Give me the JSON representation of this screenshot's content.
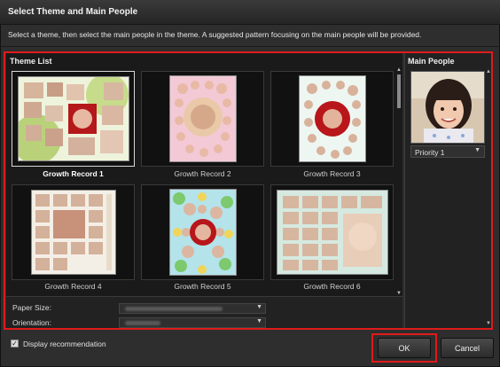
{
  "window": {
    "title": "Select Theme and Main People"
  },
  "instructions": "Select a theme, then select the main people in the theme. A suggested pattern focusing on the main people will be provided.",
  "theme_list": {
    "heading": "Theme List",
    "themes": [
      {
        "label": "Growth Record 1",
        "selected": true
      },
      {
        "label": "Growth Record 2",
        "selected": false
      },
      {
        "label": "Growth Record 3",
        "selected": false
      },
      {
        "label": "Growth Record 4",
        "selected": false
      },
      {
        "label": "Growth Record 5",
        "selected": false
      },
      {
        "label": "Growth Record 6",
        "selected": false
      }
    ]
  },
  "options": {
    "paper_size_label": "Paper Size:",
    "orientation_label": "Orientation:"
  },
  "main_people": {
    "heading": "Main People",
    "priority": "Priority 1"
  },
  "footer": {
    "display_recommendation": "Display recommendation",
    "display_recommendation_checked": true,
    "ok_label": "OK",
    "cancel_label": "Cancel"
  },
  "colors": {
    "highlight_border": "#e01b1b",
    "background": "#2b2b2b"
  }
}
